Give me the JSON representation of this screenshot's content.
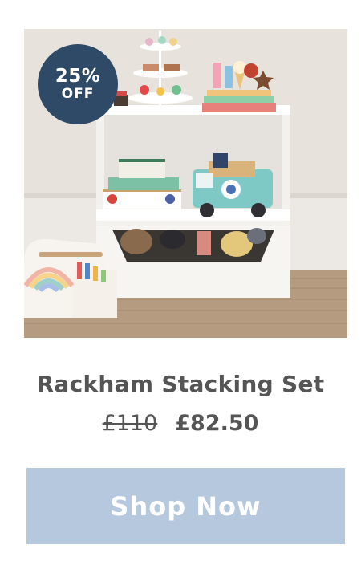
{
  "badge": {
    "percent": "25%",
    "off": "OFF"
  },
  "product": {
    "name": "Rackham Stacking Set",
    "old_price": "£110",
    "new_price": "£82.50",
    "image_icon": "product-photo"
  },
  "cta": {
    "label": "Shop Now"
  },
  "colors": {
    "badge": "#2f4a66",
    "button": "#b6c8dd",
    "text": "#555555"
  }
}
